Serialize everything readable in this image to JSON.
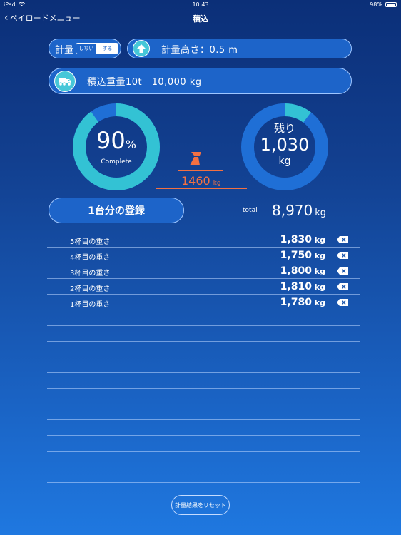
{
  "status_bar": {
    "device": "iPad",
    "time": "10:43",
    "battery": "98%"
  },
  "nav": {
    "back_label": "ペイロードメニュー",
    "title": "積込"
  },
  "measure": {
    "label": "計量",
    "options": [
      "しない",
      "する"
    ],
    "selected": "する"
  },
  "height": {
    "text": "計量高さ：0.5 m"
  },
  "weight": {
    "text": "積込重量10t　10,000 kg"
  },
  "progress": {
    "percent_value": "90",
    "percent_sign": "%",
    "complete_label": "Complete",
    "fraction": 0.9
  },
  "remaining": {
    "label": "残り",
    "value": "1,030",
    "unit": "kg",
    "fraction": 0.103
  },
  "bucket": {
    "value": "1460",
    "unit": "kg"
  },
  "register_button": "1台分の登録",
  "total": {
    "label": "total",
    "value": "8,970",
    "unit": "kg"
  },
  "entries": [
    {
      "name": "5杯目の重さ",
      "value": "1,830",
      "unit": " kg"
    },
    {
      "name": "4杯目の重さ",
      "value": "1,750",
      "unit": " kg"
    },
    {
      "name": "3杯目の重さ",
      "value": "1,800",
      "unit": " kg"
    },
    {
      "name": "2杯目の重さ",
      "value": "1,810",
      "unit": " kg"
    },
    {
      "name": "1杯目の重さ",
      "value": "1,780",
      "unit": " kg"
    }
  ],
  "reset_button": "計量結果をリセット",
  "colors": {
    "ring_teal": "#33c2d4",
    "ring_blue": "#1f6fd6",
    "accent_orange": "#f27042"
  }
}
